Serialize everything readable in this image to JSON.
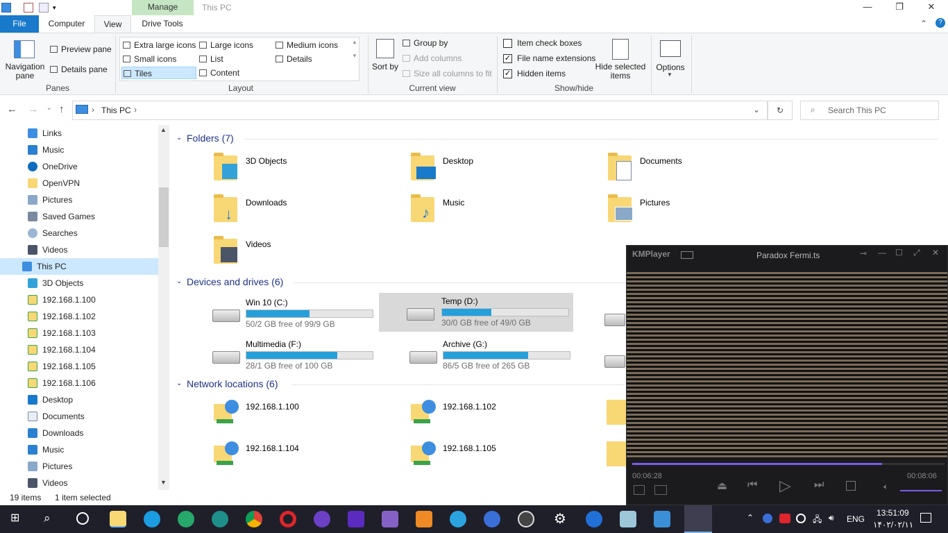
{
  "titlebar": {
    "title": "This PC",
    "manage_tab": "Manage",
    "window_controls": [
      "minimize-icon",
      "restore-icon",
      "close-icon"
    ]
  },
  "tabs": {
    "file": "File",
    "computer": "Computer",
    "view": "View",
    "drive_tools": "Drive Tools"
  },
  "ribbon": {
    "panes": {
      "navigation_pane": "Navigation pane",
      "preview_pane": "Preview pane",
      "details_pane": "Details pane",
      "label": "Panes"
    },
    "layout": {
      "items": [
        "Extra large icons",
        "Large icons",
        "Medium icons",
        "Small icons",
        "List",
        "Details",
        "Tiles",
        "Content"
      ],
      "selected": "Tiles",
      "label": "Layout"
    },
    "current_view": {
      "sort_by": "Sort by",
      "group_by": "Group by",
      "add_columns": "Add columns",
      "size_columns": "Size all columns to fit",
      "label": "Current view"
    },
    "show_hide": {
      "item_check_boxes": "Item check boxes",
      "file_name_extensions": "File name extensions",
      "hidden_items": "Hidden items",
      "checks": [
        false,
        true,
        true
      ],
      "hide_selected": "Hide selected items",
      "options": "Options",
      "label": "Show/hide"
    }
  },
  "address": {
    "crumb": "This PC",
    "search_placeholder": "Search This PC"
  },
  "nav": {
    "items": [
      "Links",
      "Music",
      "OneDrive",
      "OpenVPN",
      "Pictures",
      "Saved Games",
      "Searches",
      "Videos",
      "This PC",
      "3D Objects",
      "192.168.1.100",
      "192.168.1.102",
      "192.168.1.103",
      "192.168.1.104",
      "192.168.1.105",
      "192.168.1.106",
      "Desktop",
      "Documents",
      "Downloads",
      "Music",
      "Pictures",
      "Videos"
    ],
    "selected": "This PC"
  },
  "content": {
    "folders_header": "Folders (7)",
    "folders": [
      "3D Objects",
      "Desktop",
      "Documents",
      "Downloads",
      "Music",
      "Pictures",
      "Videos"
    ],
    "drives_header": "Devices and drives (6)",
    "drives": [
      {
        "name": "Win 10 (C:)",
        "free": "50/2 GB free of 99/9 GB",
        "used_fraction": 0.5
      },
      {
        "name": "Temp (D:)",
        "free": "30/0 GB free of 49/0 GB",
        "used_fraction": 0.39
      },
      {
        "name": "Multimedia (F:)",
        "free": "28/1 GB free of 100 GB",
        "used_fraction": 0.72
      },
      {
        "name": "Archive (G:)",
        "free": "86/5 GB free of 265 GB",
        "used_fraction": 0.67
      }
    ],
    "network_header": "Network locations (6)",
    "network": [
      "192.168.1.100",
      "192.168.1.102",
      "192.168.1.104",
      "192.168.1.105"
    ]
  },
  "status": {
    "count": "19 items",
    "selected": "1 item selected"
  },
  "kmplayer": {
    "logo": "KMPlayer",
    "title": "Paradox Fermi.ts",
    "elapsed": "00:06:28",
    "total": "00:08:06",
    "progress_fraction": 0.8
  },
  "taskbar": {
    "lang": "ENG",
    "time": "13:51:09",
    "date": "۱۴۰۲/۰۲/۱۱"
  },
  "colors": {
    "accent": "#1979ca",
    "selection": "#cce8ff",
    "manage": "#c6e6c3",
    "km_progress": "#7a5de8"
  }
}
